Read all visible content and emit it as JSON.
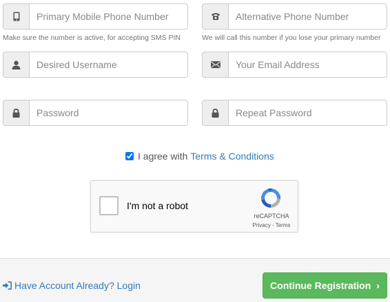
{
  "form": {
    "primary_phone": {
      "placeholder": "Primary Mobile Phone Number",
      "help": "Make sure the number is active, for accepting SMS PIN",
      "icon": "mobile-icon"
    },
    "alt_phone": {
      "placeholder": "Alternative Phone Number",
      "help": "We will call this number if you lose your primary number",
      "icon": "phone-icon"
    },
    "username": {
      "placeholder": "Desired Username",
      "icon": "user-icon"
    },
    "email": {
      "placeholder": "Your Email Address",
      "icon": "envelope-icon"
    },
    "password": {
      "placeholder": "Password",
      "icon": "lock-icon"
    },
    "repeat_password": {
      "placeholder": "Repeat Password",
      "icon": "lock-icon"
    },
    "agree": {
      "checked": true,
      "prefix": "I agree with",
      "link": "Terms & Conditions"
    }
  },
  "captcha": {
    "label": "I'm not a robot",
    "brand": "reCAPTCHA",
    "terms": "Privacy - Terms"
  },
  "footer": {
    "login_link": "Have Account Already? Login",
    "continue_label": "Continue Registration",
    "chevron": "›"
  },
  "colors": {
    "link": "#337ab7",
    "success": "#5cb85c",
    "addon_bg": "#eeeeee",
    "border": "#cccccc"
  }
}
